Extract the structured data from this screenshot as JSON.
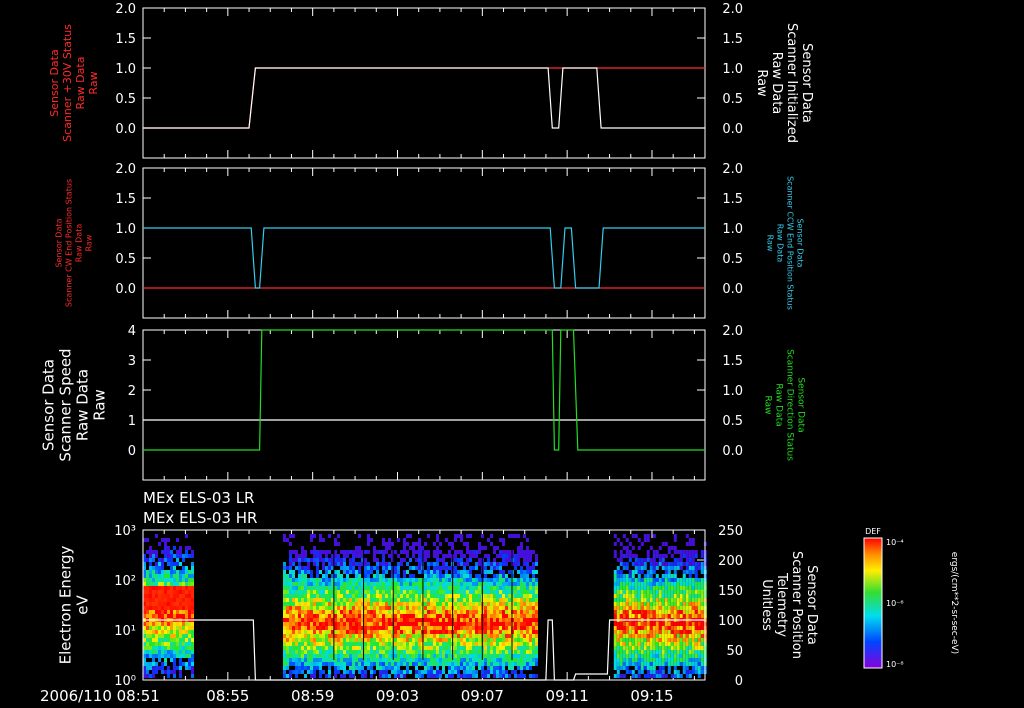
{
  "time_axis": {
    "date_label": "2006/110 08:51",
    "ticks": [
      "08:55",
      "08:59",
      "09:03",
      "09:07",
      "09:11",
      "09:15"
    ]
  },
  "legend": {
    "title": "DEF",
    "ticks": [
      "10⁻⁴",
      "10⁻⁶",
      "10⁻⁸"
    ],
    "unit": "ergs/(cm**2-sr-sec-eV)"
  },
  "colors": {
    "red": "#ff2a2a",
    "cyan": "#33ccee",
    "green": "#22dd22",
    "white": "#ffffff"
  },
  "chart_data": [
    {
      "type": "line",
      "panel": 1,
      "left_label": [
        "Sensor Data",
        "Scanner +30V Status",
        "Raw Data",
        "Raw"
      ],
      "right_label": [
        "Sensor Data",
        "Scanner Initialized",
        "Raw Data",
        "Raw"
      ],
      "left_ticks": [
        "2.0",
        "1.5",
        "1.0",
        "0.5",
        "0.0"
      ],
      "right_ticks": [
        "2.0",
        "1.5",
        "1.0",
        "0.5",
        "0.0"
      ],
      "xlim": [
        "08:51",
        "09:17"
      ],
      "ylim": [
        -0.5,
        2.0
      ],
      "series": [
        {
          "color": "red",
          "x": [
            0,
            5.0,
            5.3,
            19.1,
            19.6,
            26.5
          ],
          "y": [
            0,
            0,
            1,
            1,
            1,
            1
          ]
        },
        {
          "color": "white",
          "x": [
            0,
            5.0,
            5.3,
            19.1,
            19.3,
            19.6,
            19.8,
            21.4,
            21.6,
            26.5
          ],
          "y": [
            0,
            0,
            1,
            1,
            0,
            0,
            1,
            1,
            0,
            0
          ]
        }
      ]
    },
    {
      "type": "line",
      "panel": 2,
      "left_label": [
        "Sensor Data",
        "Scanner CW End Position Status",
        "Raw Data",
        "Raw"
      ],
      "right_label": [
        "Sensor Data",
        "Scanner CCW End Position Status",
        "Raw Data",
        "Raw"
      ],
      "left_ticks": [
        "2.0",
        "1.5",
        "1.0",
        "0.5",
        "0.0"
      ],
      "right_ticks": [
        "2.0",
        "1.5",
        "1.0",
        "0.5",
        "0.0"
      ],
      "xlim": [
        "08:51",
        "09:17"
      ],
      "ylim": [
        -0.5,
        2.0
      ],
      "series": [
        {
          "color": "red",
          "x": [
            0,
            5.2,
            5.4,
            19.3,
            19.5,
            26.5
          ],
          "y": [
            0,
            0,
            0,
            0,
            0,
            0
          ]
        },
        {
          "color": "cyan",
          "x": [
            0,
            5.1,
            5.3,
            5.5,
            5.7,
            19.2,
            19.4,
            19.7,
            19.9,
            20.2,
            20.4,
            21.5,
            21.7,
            26.5
          ],
          "y": [
            1,
            1,
            0,
            0,
            1,
            1,
            0,
            0,
            1,
            1,
            0,
            0,
            1,
            1
          ]
        }
      ]
    },
    {
      "type": "line",
      "panel": 3,
      "left_label": [
        "Sensor Data",
        "Scanner Speed",
        "Raw Data",
        "Raw"
      ],
      "right_label": [
        "Sensor Data",
        "Scanner Direction Status",
        "Raw Data",
        "Raw"
      ],
      "left_ticks": [
        "4",
        "3",
        "2",
        "1",
        "0"
      ],
      "right_ticks": [
        "2.0",
        "1.5",
        "1.0",
        "0.5",
        "0.0"
      ],
      "xlim": [
        "08:51",
        "09:17"
      ],
      "ylim": [
        -1,
        4
      ],
      "series": [
        {
          "color": "white",
          "x": [
            0,
            26.5
          ],
          "y": [
            1,
            1
          ]
        },
        {
          "color": "green",
          "x": [
            0,
            5.5,
            5.6,
            19.3,
            19.4,
            19.6,
            19.7,
            20.3,
            20.5,
            26.5
          ],
          "y": [
            0,
            0,
            2,
            2,
            0,
            0,
            2,
            2,
            0,
            0
          ]
        }
      ]
    },
    {
      "type": "heatmap",
      "panel": 4,
      "header": [
        "MEx ELS-03 LR",
        "MEx ELS-03 HR"
      ],
      "left_label": [
        "Electron Energy",
        "eV"
      ],
      "right_label": [
        "Sensor Data",
        "Scanner Position",
        "Telemetry",
        "Unitless"
      ],
      "left_ticks": [
        "10³",
        "10²",
        "10¹",
        "10⁰"
      ],
      "right_ticks": [
        "250",
        "200",
        "150",
        "100",
        "50",
        "0"
      ],
      "xlim": [
        "08:51",
        "09:17"
      ],
      "ylim": [
        1,
        1000
      ],
      "yscale": "log",
      "data_intervals": [
        [
          0,
          2.3
        ],
        [
          6.6,
          18.6
        ],
        [
          22.2,
          26.5
        ]
      ],
      "line": {
        "color": "white",
        "x": [
          0,
          5.2,
          5.3,
          19.0,
          19.1,
          19.3,
          19.4,
          20.3,
          20.4,
          21.9,
          22.0,
          26.5
        ],
        "y": [
          100,
          100,
          0,
          0,
          100,
          100,
          0,
          0,
          10,
          10,
          100,
          100
        ]
      }
    }
  ]
}
